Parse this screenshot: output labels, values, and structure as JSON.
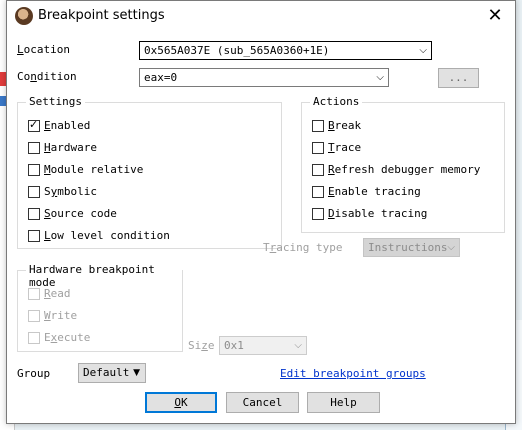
{
  "dialog": {
    "title": "Breakpoint settings",
    "close_glyph": "✕"
  },
  "location": {
    "label": "Location",
    "value": "0x565A037E (sub_565A0360+1E)"
  },
  "condition": {
    "label": "Condition",
    "value": "eax=0",
    "browse_label": "..."
  },
  "settings": {
    "title": "Settings",
    "items": [
      {
        "label": "Enabled",
        "checked": true
      },
      {
        "label": "Hardware",
        "checked": false
      },
      {
        "label": "Module relative",
        "checked": false
      },
      {
        "label": "Symbolic",
        "checked": false
      },
      {
        "label": "Source code",
        "checked": false
      },
      {
        "label": "Low level condition",
        "checked": false
      }
    ]
  },
  "actions": {
    "title": "Actions",
    "items": [
      {
        "label": "Break",
        "checked": false
      },
      {
        "label": "Trace",
        "checked": false
      },
      {
        "label": "Refresh debugger memory",
        "checked": false
      },
      {
        "label": "Enable tracing",
        "checked": false
      },
      {
        "label": "Disable tracing",
        "checked": false
      }
    ]
  },
  "tracing": {
    "label": "Tracing type",
    "value": "Instructions"
  },
  "hw_mode": {
    "title": "Hardware breakpoint mode",
    "items": [
      {
        "label": "Read"
      },
      {
        "label": "Write"
      },
      {
        "label": "Execute"
      }
    ]
  },
  "size": {
    "label": "Size",
    "value": "0x1"
  },
  "group": {
    "label": "Group",
    "value": "Default"
  },
  "links": {
    "edit_groups": "Edit breakpoint groups"
  },
  "buttons": {
    "ok": "OK",
    "cancel": "Cancel",
    "help": "Help"
  },
  "colors": {
    "accent": "#0078d7",
    "link": "#0033cc",
    "disabled_text": "#a0a0a0"
  }
}
